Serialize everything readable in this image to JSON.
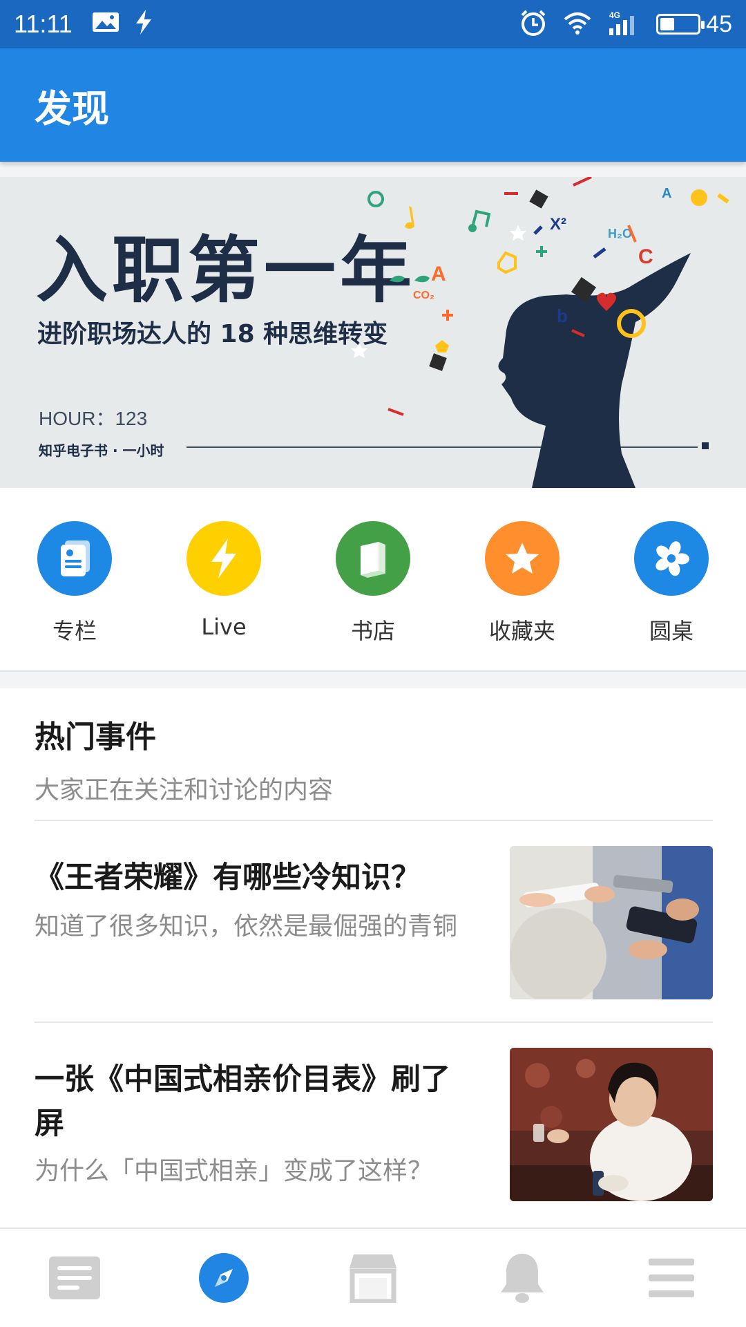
{
  "status_bar": {
    "time": "11:11",
    "battery": "45",
    "battery_level": 0.45,
    "icons": [
      "image-icon",
      "flash-icon",
      "alarm-icon",
      "wifi-icon",
      "signal-4g-icon",
      "battery-icon"
    ]
  },
  "header": {
    "title": "发现"
  },
  "banner": {
    "title": "入职第一年",
    "subtitle": "进阶职场达人的 18 种思维转变",
    "hour": "HOUR：123",
    "brand": "知乎电子书 · 一小时"
  },
  "quick_links": [
    {
      "label": "专栏",
      "icon": "column-icon",
      "color": "#1e88e5"
    },
    {
      "label": "Live",
      "icon": "lightning-icon",
      "color": "#ffd000"
    },
    {
      "label": "书店",
      "icon": "book-icon",
      "color": "#43a047"
    },
    {
      "label": "收藏夹",
      "icon": "star-icon",
      "color": "#ff8f2c"
    },
    {
      "label": "圆桌",
      "icon": "pinwheel-icon",
      "color": "#1e88e5"
    }
  ],
  "hot": {
    "title": "热门事件",
    "subtitle": "大家正在关注和讨论的内容",
    "articles": [
      {
        "title": "《王者荣耀》有哪些冷知识？",
        "summary": "知道了很多知识，依然是最倔强的青铜"
      },
      {
        "title": "一张《中国式相亲价目表》刷了屏",
        "summary": "为什么「中国式相亲」变成了这样？"
      }
    ]
  },
  "bottom_nav": [
    {
      "icon": "feed-icon",
      "active": false
    },
    {
      "icon": "compass-icon",
      "active": true
    },
    {
      "icon": "store-icon",
      "active": false
    },
    {
      "icon": "bell-icon",
      "active": false
    },
    {
      "icon": "menu-icon",
      "active": false
    }
  ],
  "colors": {
    "primary": "#2185e4",
    "status_bar": "#1b68c0",
    "inactive_icon": "#cfcfcf"
  }
}
